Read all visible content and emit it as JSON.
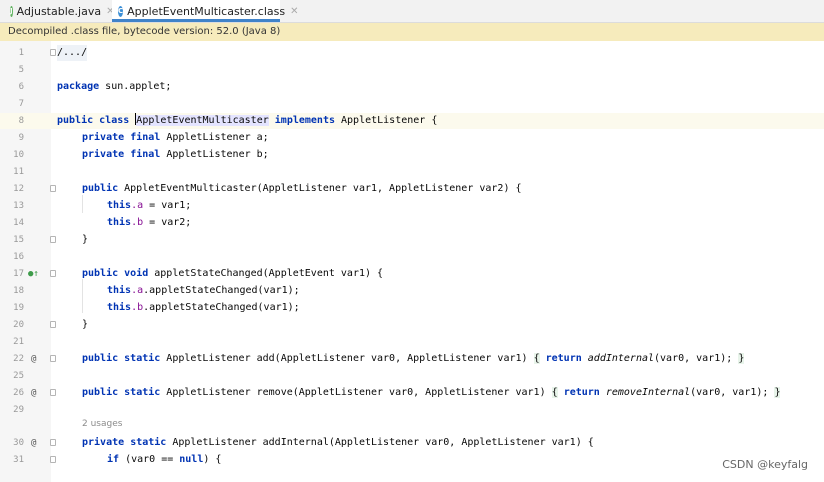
{
  "tabs": [
    {
      "label": "Adjustable.java",
      "icon": "java-file-icon",
      "active": false
    },
    {
      "label": "AppletEventMulticaster.class",
      "icon": "class-file-icon",
      "active": true
    }
  ],
  "banner": {
    "text": "Decompiled .class file, bytecode version: 52.0 (Java 8)"
  },
  "code": {
    "l1": "1",
    "l5": "5",
    "l6": "6",
    "l7": "7",
    "l8": "8",
    "l9": "9",
    "l10": "10",
    "l11": "11",
    "l12": "12",
    "l13": "13",
    "l14": "14",
    "l15": "15",
    "l16": "16",
    "l17": "17",
    "l18": "18",
    "l19": "19",
    "l20": "20",
    "l21": "21",
    "l22": "22",
    "l25": "25",
    "l26": "26",
    "l29": "29",
    "l30": "30",
    "l31": "31",
    "header_comment": "/.../",
    "kw_package": "package",
    "package_name": " sun.applet;",
    "kw_public": "public",
    "kw_class": "class",
    "class_name": "AppletEventMulticaster",
    "kw_implements": "implements",
    "interface_rest": " AppletListener {",
    "kw_private": "private",
    "kw_final": "final",
    "field_type": " AppletListener ",
    "field_a": "a;",
    "field_b": "b;",
    "ctor_sig": " AppletEventMulticaster(AppletListener var1, AppletListener var2) {",
    "kw_this": "this",
    "this_a": ".a",
    "assign1": " = var1;",
    "this_b": ".b",
    "assign2": " = var2;",
    "close_brace": "}",
    "kw_void": "void",
    "method1_sig": " appletStateChanged(AppletEvent var1) {",
    "call1": ".appletStateChanged(var1);",
    "kw_static": "static",
    "add_sig": " AppletListener add(AppletListener var0, AppletListener var1) ",
    "open_brace": "{",
    "kw_return": "return",
    "add_internal_call": "addInternal",
    "call_args": "(var0, var1);",
    "remove_sig": " AppletListener remove(AppletListener var0, AppletListener var1) ",
    "remove_internal_call": "removeInternal",
    "usages": "2 usages",
    "addinternal_sig": " AppletListener addInternal(AppletListener var0, AppletListener var1) {",
    "kw_if": "if",
    "if_cond": " (var0 == ",
    "kw_null": "null",
    "if_end": ") {"
  },
  "gutter_icons": {
    "override": "@",
    "implements": "●↑"
  },
  "watermark": "CSDN @keyfalg",
  "colors": {
    "keyword": "#0033b3",
    "field": "#871094",
    "banner_bg": "#f6ebbc",
    "tab_underline": "#4083c9"
  }
}
